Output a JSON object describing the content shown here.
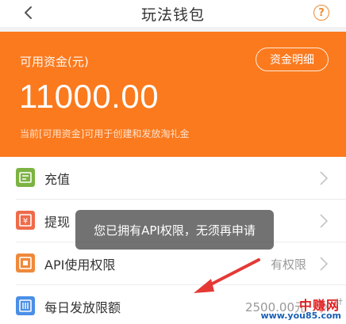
{
  "header": {
    "title": "玩法钱包",
    "help_icon_text": "?"
  },
  "balance": {
    "label": "可用资金(元)",
    "detail_button": "资金明细",
    "amount": "11000.00",
    "note": "当前[可用资金]可用于创建和发放淘礼金"
  },
  "menu": [
    {
      "label": "充值",
      "icon": "recharge-icon",
      "icon_color": "#7cb342",
      "value": ""
    },
    {
      "label": "提现",
      "icon": "withdraw-icon",
      "icon_color": "#ef6b4a",
      "value": ""
    },
    {
      "label": "API使用权限",
      "icon": "api-icon",
      "icon_color": "#f0893a",
      "value": "有权限"
    },
    {
      "label": "每日发放限额",
      "icon": "daily-limit-icon",
      "icon_color": "#4a8fe7",
      "value": "2500.00元"
    }
  ],
  "toast": {
    "message": "您已拥有API权限，无须再申请"
  },
  "watermark": {
    "top": "中赚网",
    "bottom": "www.you85.com",
    "small": "计"
  },
  "colors": {
    "accent": "#fb7a1e",
    "annotation_arrow": "#e53935"
  }
}
